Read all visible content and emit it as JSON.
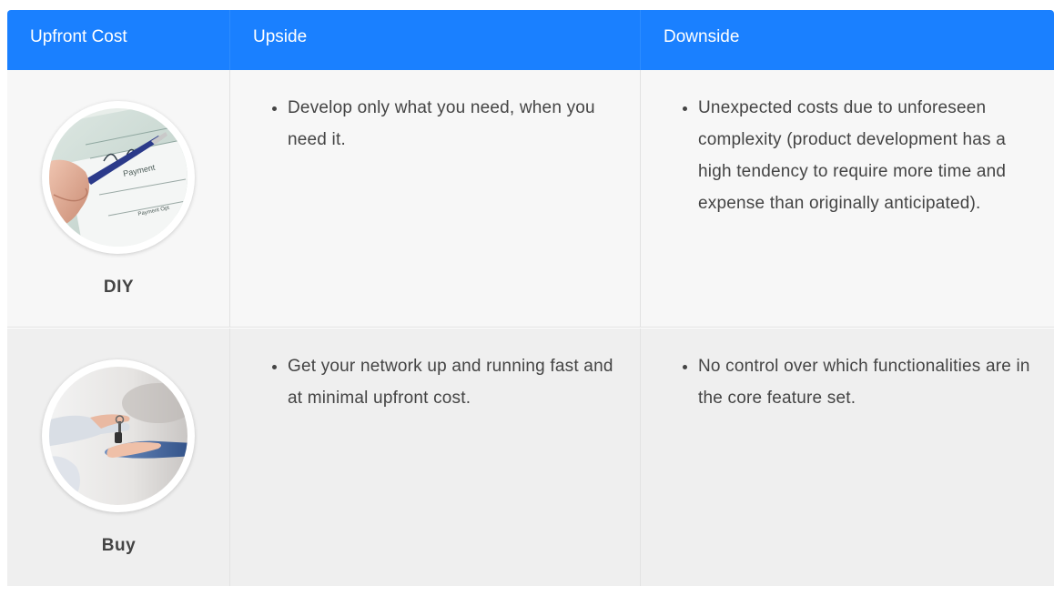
{
  "table": {
    "headers": [
      "Upfront Cost",
      "Upside",
      "Downside"
    ],
    "rows": [
      {
        "option": "DIY",
        "image": "check-signing-photo",
        "upside": [
          "Develop only what you need, when you need it."
        ],
        "downside": [
          "Unexpected costs due to unforeseen complexity (product development has a high tendency to require more time and expense than originally anticipated)."
        ]
      },
      {
        "option": "Buy",
        "image": "key-handover-photo",
        "upside": [
          "Get your network up and running fast and at minimal upfront cost."
        ],
        "downside": [
          "No control over which functionalities are in the core feature set."
        ]
      }
    ]
  },
  "colors": {
    "header_bg": "#1a80ff",
    "header_border": "#0f63cc",
    "row1_bg": "#f7f7f7",
    "row2_bg": "#efefef",
    "text": "#444444"
  }
}
